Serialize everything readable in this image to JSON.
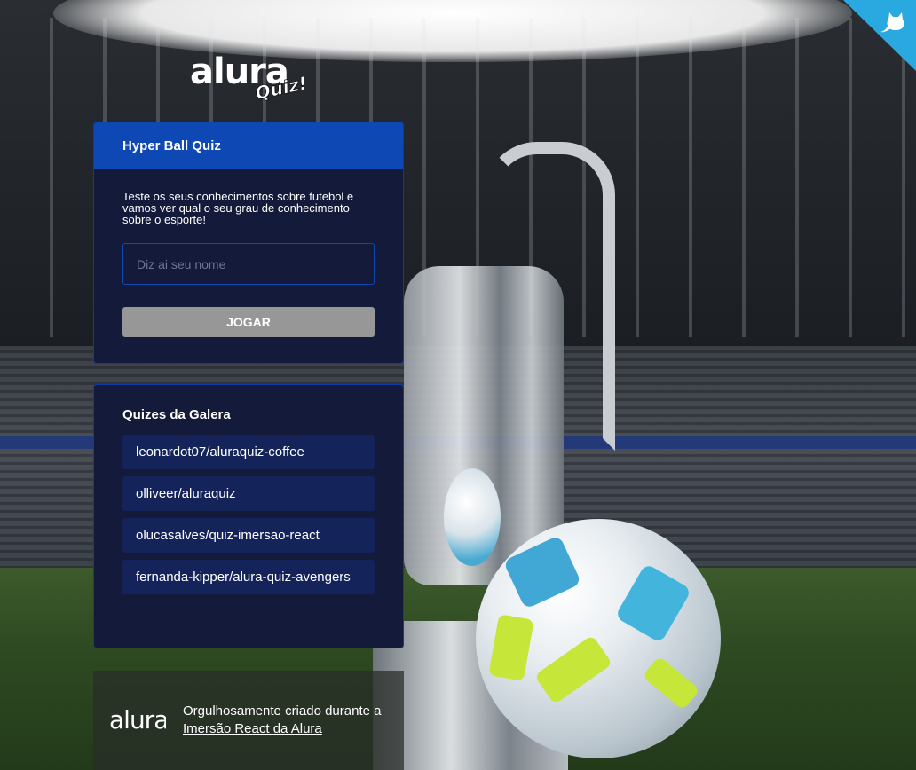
{
  "logo": {
    "main": "alura",
    "sub": "Quiz!"
  },
  "quiz_card": {
    "title": "Hyper Ball Quiz",
    "description": "Teste os seus conhecimentos sobre futebol e vamos ver qual o seu grau de conhecimento sobre o esporte!",
    "name_input": {
      "placeholder": "Diz ai seu nome",
      "value": ""
    },
    "play_button": "JOGAR"
  },
  "gallery_card": {
    "title": "Quizes da Galera",
    "items": [
      "leonardot07/aluraquiz-coffee",
      "olliveer/aluraquiz",
      "olucasalves/quiz-imersao-react",
      "fernanda-kipper/alura-quiz-avengers"
    ]
  },
  "footer": {
    "logo": "alura",
    "text_prefix": "Orgulhosamente criado durante a ",
    "link_text": "Imersão React da Alura"
  },
  "colors": {
    "card_bg": "#141a3a",
    "card_header": "#0e48b5",
    "button_disabled": "#979797",
    "list_item_bg": "#14245a",
    "github_corner": "#2aa9e0"
  },
  "icons": {
    "github_corner": "github-octocat-icon"
  }
}
